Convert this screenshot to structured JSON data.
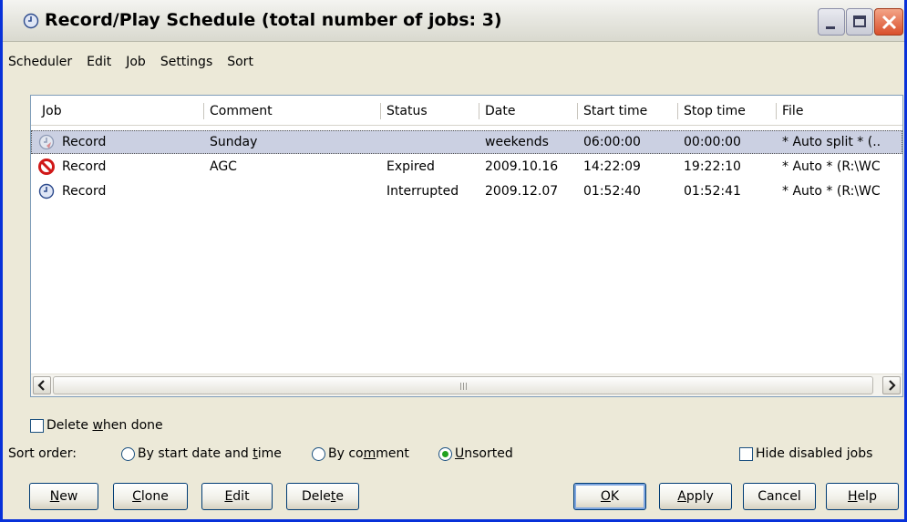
{
  "window": {
    "title": "Record/Play Schedule (total number of jobs: 3)"
  },
  "menu": [
    "Scheduler",
    "Edit",
    "Job",
    "Settings",
    "Sort"
  ],
  "table": {
    "columns": [
      "Job",
      "Comment",
      "Status",
      "Date",
      "Start time",
      "Stop time",
      "File"
    ],
    "rows": [
      {
        "icon": "clock-disabled-icon",
        "job": "Record",
        "comment": "Sunday",
        "status": "",
        "date": "weekends",
        "start": "06:00:00",
        "stop": "00:00:00",
        "file": "* Auto split * (..",
        "selected": true
      },
      {
        "icon": "expired-icon",
        "job": "Record",
        "comment": "AGC",
        "status": "Expired",
        "date": "2009.10.16",
        "start": "14:22:09",
        "stop": "19:22:10",
        "file": "* Auto * (R:\\WC",
        "selected": false
      },
      {
        "icon": "clock-icon",
        "job": "Record",
        "comment": "",
        "status": "Interrupted",
        "date": "2009.12.07",
        "start": "01:52:40",
        "stop": "01:52:41",
        "file": "* Auto * (R:\\WC",
        "selected": false
      }
    ]
  },
  "options": {
    "delete_when_done": {
      "pre": "Delete ",
      "ul": "w",
      "post": "hen done",
      "checked": false
    },
    "sort_label": "Sort order:",
    "sort_start": {
      "pre": "By start date and ",
      "ul": "t",
      "post": "ime",
      "checked": false
    },
    "sort_comment": {
      "pre": "By co",
      "ul": "m",
      "post": "ment",
      "checked": false
    },
    "sort_unsorted": {
      "pre": "",
      "ul": "U",
      "post": "nsorted",
      "checked": true
    },
    "hide_disabled": {
      "pre": "Hide disabled ",
      "ul": "j",
      "post": "obs",
      "checked": false
    }
  },
  "buttons": {
    "new": {
      "ul": "N",
      "post": "ew"
    },
    "clone": {
      "ul": "C",
      "post": "lone"
    },
    "edit": {
      "ul": "E",
      "post": "dit"
    },
    "delete": {
      "pre": "Dele",
      "ul": "t",
      "post": "e"
    },
    "ok": {
      "ul": "O",
      "post": "K"
    },
    "apply": {
      "ul": "A",
      "post": "pply"
    },
    "cancel": "Cancel",
    "help": {
      "ul": "H",
      "post": "elp"
    }
  }
}
